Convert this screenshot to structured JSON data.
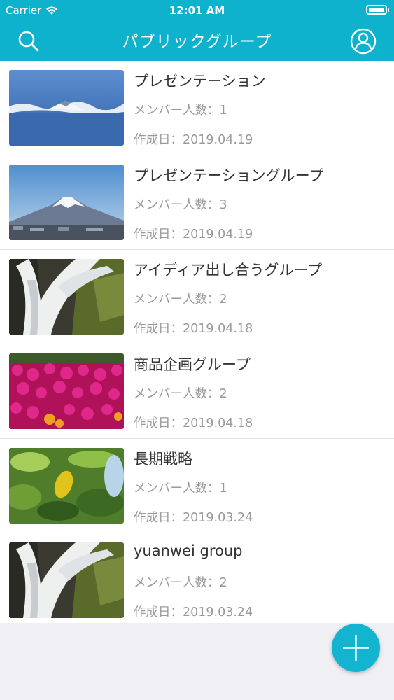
{
  "status_bar": {
    "carrier": "Carrier",
    "time": "12:01 AM"
  },
  "nav": {
    "title": "パブリックグループ",
    "left_icon": "search-icon",
    "right_icon": "profile-icon"
  },
  "colors": {
    "accent": "#0fb2cc",
    "title_text": "#333333",
    "meta_text": "#999999"
  },
  "groups": [
    {
      "title": "プレゼンテーション",
      "members": "メンバー人数：1",
      "created": "作成日：2019.04.19",
      "image": "mount-fuji-clouds"
    },
    {
      "title": "プレゼンテーショングループ",
      "members": "メンバー人数：3",
      "created": "作成日：2019.04.19",
      "image": "mount-fuji-city"
    },
    {
      "title": "アイディア出し合うグループ",
      "members": "メンバー人数：2",
      "created": "作成日：2019.04.18",
      "image": "waterfall"
    },
    {
      "title": "商品企画グループ",
      "members": "メンバー人数：2",
      "created": "作成日：2019.04.18",
      "image": "pink-flowers"
    },
    {
      "title": "長期戦略",
      "members": "メンバー人数：1",
      "created": "作成日：2019.03.24",
      "image": "green-leaves"
    },
    {
      "title": "yuanwei group",
      "members": "メンバー人数：2",
      "created": "作成日：2019.03.24",
      "image": "waterfall"
    }
  ],
  "fab": {
    "icon": "plus-icon"
  }
}
